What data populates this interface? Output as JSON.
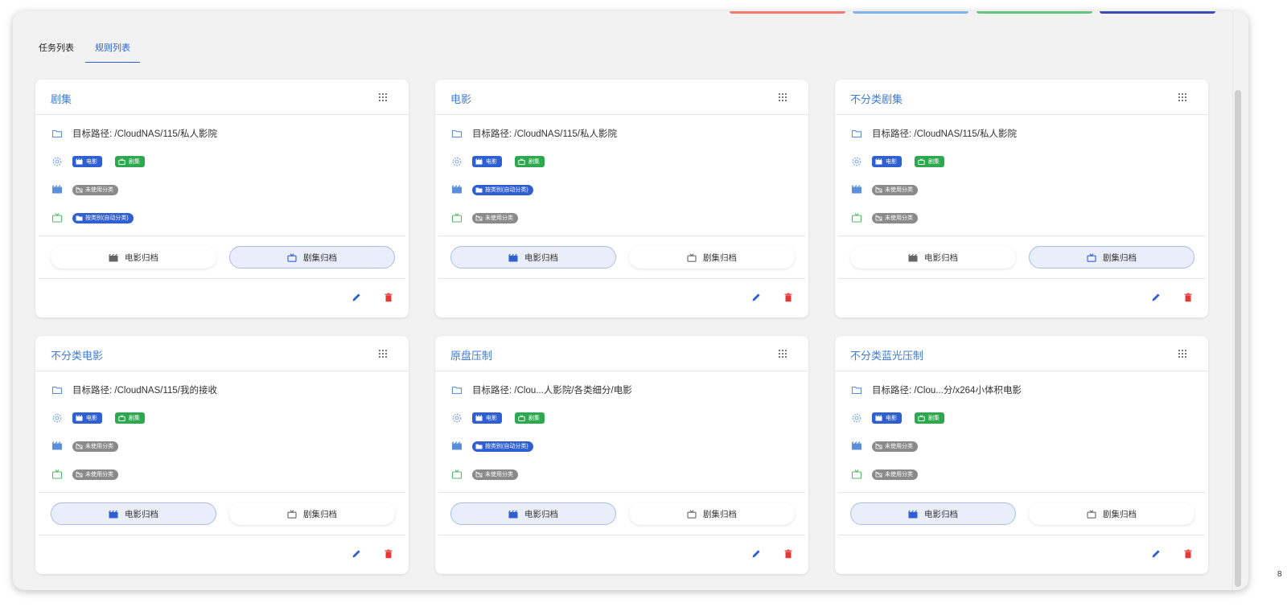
{
  "tabs": {
    "task_list": "任务列表",
    "rule_list": "规则列表",
    "active": "rule_list"
  },
  "top_bar_colors": [
    "#ef7b6c",
    "#7fb4e6",
    "#69c27c",
    "#3a4fb5"
  ],
  "colors": {
    "accent": "#2f5fd0",
    "title": "#3e7bd4",
    "movie_chip": "#2f5fd0",
    "tv_chip": "#2ea84f",
    "unused_pill": "#8a8a8a",
    "delete": "#e53935"
  },
  "labels": {
    "path_prefix": "目标路径: ",
    "chip_movie": "电影",
    "chip_tv": "剧集",
    "pill_unused": "未使用分类",
    "pill_auto": "按类别(自动分类)",
    "btn_movie": "电影归档",
    "btn_tv": "剧集归档"
  },
  "cards": [
    {
      "title": "剧集",
      "path": "目标路径: /CloudNAS/115/私人影院",
      "chip_movie": "电影",
      "chip_tv": "剧集",
      "movie_category": "未使用分类",
      "tv_category": "按类别(自动分类)",
      "btn_movie": "电影归档",
      "btn_tv": "剧集归档",
      "active_archive": "tv"
    },
    {
      "title": "电影",
      "path": "目标路径: /CloudNAS/115/私人影院",
      "chip_movie": "电影",
      "chip_tv": "剧集",
      "movie_category": "按类别(自动分类)",
      "tv_category": "未使用分类",
      "btn_movie": "电影归档",
      "btn_tv": "剧集归档",
      "active_archive": "movie"
    },
    {
      "title": "不分类剧集",
      "path": "目标路径: /CloudNAS/115/私人影院",
      "chip_movie": "电影",
      "chip_tv": "剧集",
      "movie_category": "未使用分类",
      "tv_category": "未使用分类",
      "btn_movie": "电影归档",
      "btn_tv": "剧集归档",
      "active_archive": "tv"
    },
    {
      "title": "不分类电影",
      "path": "目标路径: /CloudNAS/115/我的接收",
      "chip_movie": "电影",
      "chip_tv": "剧集",
      "movie_category": "未使用分类",
      "tv_category": "未使用分类",
      "btn_movie": "电影归档",
      "btn_tv": "剧集归档",
      "active_archive": "movie"
    },
    {
      "title": "原盘压制",
      "path": "目标路径: /Clou...人影院/各类细分/电影",
      "chip_movie": "电影",
      "chip_tv": "剧集",
      "movie_category": "按类别(自动分类)",
      "tv_category": "未使用分类",
      "btn_movie": "电影归档",
      "btn_tv": "剧集归档",
      "active_archive": "movie"
    },
    {
      "title": "不分类蓝光压制",
      "path": "目标路径: /Clou...分/x264小体积电影",
      "chip_movie": "电影",
      "chip_tv": "剧集",
      "movie_category": "未使用分类",
      "tv_category": "未使用分类",
      "btn_movie": "电影归档",
      "btn_tv": "剧集归档",
      "active_archive": "movie"
    }
  ],
  "corner_glyph": "8"
}
